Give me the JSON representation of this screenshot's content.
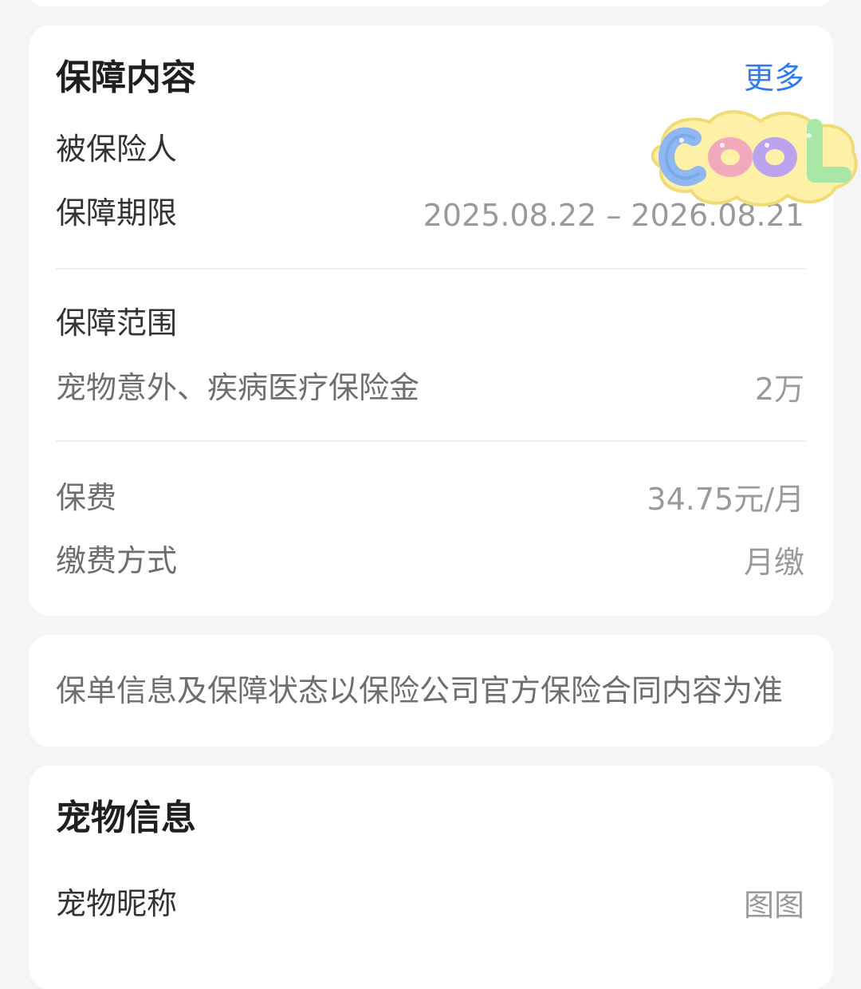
{
  "coverage": {
    "title": "保障内容",
    "more_label": "更多",
    "insured_label": "被保险人",
    "period_label": "保障期限",
    "period_value": "2025.08.22 – 2026.08.21",
    "scope_title": "保障范围",
    "scope_item_label": "宠物意外、疾病医疗保险金",
    "scope_item_value": "2万",
    "premium_label": "保费",
    "premium_value": "34.75元/月",
    "payment_method_label": "缴费方式",
    "payment_method_value": "月缴"
  },
  "notice": {
    "text": "保单信息及保障状态以保险公司官方保险合同内容为准"
  },
  "pet_info": {
    "title": "宠物信息",
    "nickname_label": "宠物昵称",
    "nickname_value": "图图"
  },
  "sticker": {
    "text": "COOL",
    "icon": "cool-sticker-icon",
    "colors": {
      "background": "#fff0a8",
      "c": "#8fb7f2",
      "o1": "#f3a9bc",
      "o2": "#bca3ef",
      "l": "#a9e7a7"
    }
  },
  "colors": {
    "page_bg": "#f5f5f5",
    "card_bg": "#ffffff",
    "accent": "#2f7bf5",
    "title_text": "#1f1f1f",
    "label_text": "#333333",
    "muted_text": "#9a9a9a"
  }
}
